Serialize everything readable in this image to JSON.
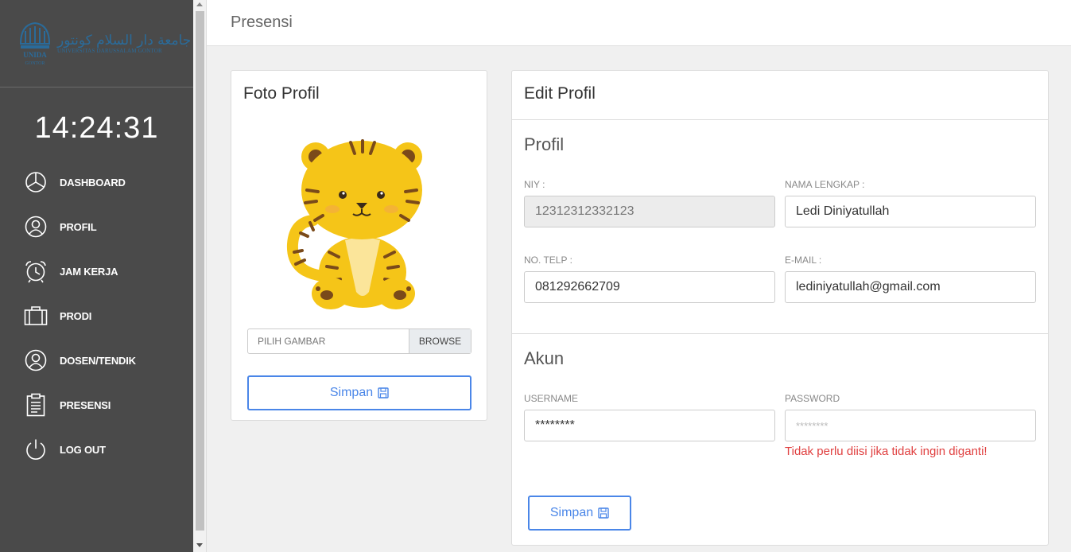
{
  "sidebar": {
    "logo": {
      "arabic": "جامعة دار السلام كونتور",
      "latin": "UNIVERSITAS DARUSSALAM GONTOR",
      "emblem_text": "UNIDA",
      "emblem_subtext": "GONTOR"
    },
    "clock": "14:24:31",
    "items": [
      {
        "label": "DASHBOARD",
        "icon": "pie-chart-icon"
      },
      {
        "label": "PROFIL",
        "icon": "user-circle-icon"
      },
      {
        "label": "JAM KERJA",
        "icon": "alarm-clock-icon"
      },
      {
        "label": "PRODI",
        "icon": "briefcase-icon"
      },
      {
        "label": "DOSEN/TENDIK",
        "icon": "user-circle-icon"
      },
      {
        "label": "PRESENSI",
        "icon": "clipboard-icon"
      },
      {
        "label": "LOG OUT",
        "icon": "power-icon"
      }
    ]
  },
  "header": {
    "title": "Presensi"
  },
  "photo_card": {
    "title": "Foto Profil",
    "file_placeholder": "PILIH GAMBAR",
    "browse_label": "BROWSE",
    "save_label": "Simpan"
  },
  "edit_card": {
    "title": "Edit Profil",
    "profile_section": "Profil",
    "niy_label": "NIY :",
    "niy_value": "12312312332123",
    "name_label": "NAMA LENGKAP :",
    "name_value": "Ledi Diniyatullah",
    "phone_label": "NO. TELP :",
    "phone_value": "081292662709",
    "email_label": "E-MAIL :",
    "email_value": "lediniyatullah@gmail.com",
    "account_section": "Akun",
    "username_label": "USERNAME",
    "username_value": "********",
    "password_label": "PASSWORD",
    "password_placeholder": "********",
    "password_warning": "Tidak perlu diisi jika tidak ingin diganti!",
    "save_label": "Simpan"
  },
  "colors": {
    "sidebar_bg": "#4a4a4a",
    "accent": "#4a86e8",
    "warning": "#e04040"
  }
}
